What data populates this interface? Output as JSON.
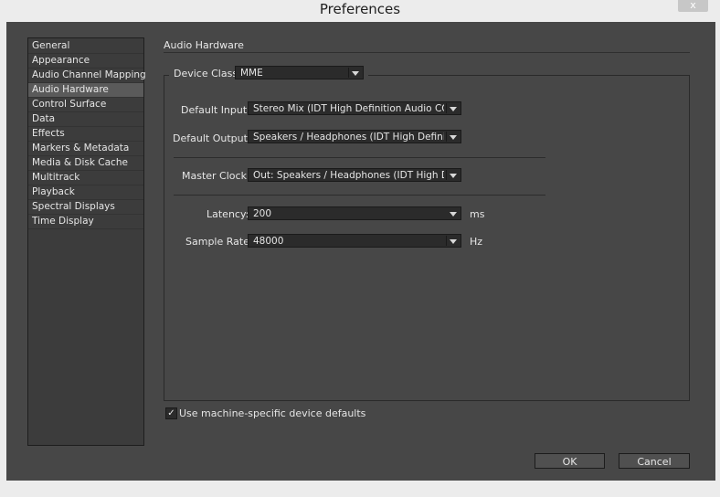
{
  "window": {
    "title": "Preferences",
    "close_glyph": "x"
  },
  "sidebar": {
    "items": [
      {
        "label": "General"
      },
      {
        "label": "Appearance"
      },
      {
        "label": "Audio Channel Mapping"
      },
      {
        "label": "Audio Hardware",
        "selected": true
      },
      {
        "label": "Control Surface"
      },
      {
        "label": "Data"
      },
      {
        "label": "Effects"
      },
      {
        "label": "Markers & Metadata"
      },
      {
        "label": "Media & Disk Cache"
      },
      {
        "label": "Multitrack"
      },
      {
        "label": "Playback"
      },
      {
        "label": "Spectral Displays"
      },
      {
        "label": "Time Display"
      }
    ]
  },
  "panel": {
    "heading": "Audio Hardware",
    "device_class": {
      "label": "Device Class:",
      "value": "MME"
    },
    "default_input": {
      "label": "Default Input:",
      "value": "Stereo Mix (IDT High Definition Audio CO..."
    },
    "default_output": {
      "label": "Default Output:",
      "value": "Speakers / Headphones (IDT High Definiti..."
    },
    "master_clock": {
      "label": "Master Clock:",
      "value": "Out: Speakers / Headphones (IDT High D..."
    },
    "latency": {
      "label": "Latency:",
      "value": "200",
      "unit": "ms"
    },
    "sample_rate": {
      "label": "Sample Rate:",
      "value": "48000",
      "unit": "Hz"
    },
    "machine_defaults": {
      "label": "Use machine-specific device defaults",
      "checked": true,
      "check_glyph": "✓"
    }
  },
  "buttons": {
    "ok": "OK",
    "cancel": "Cancel"
  }
}
